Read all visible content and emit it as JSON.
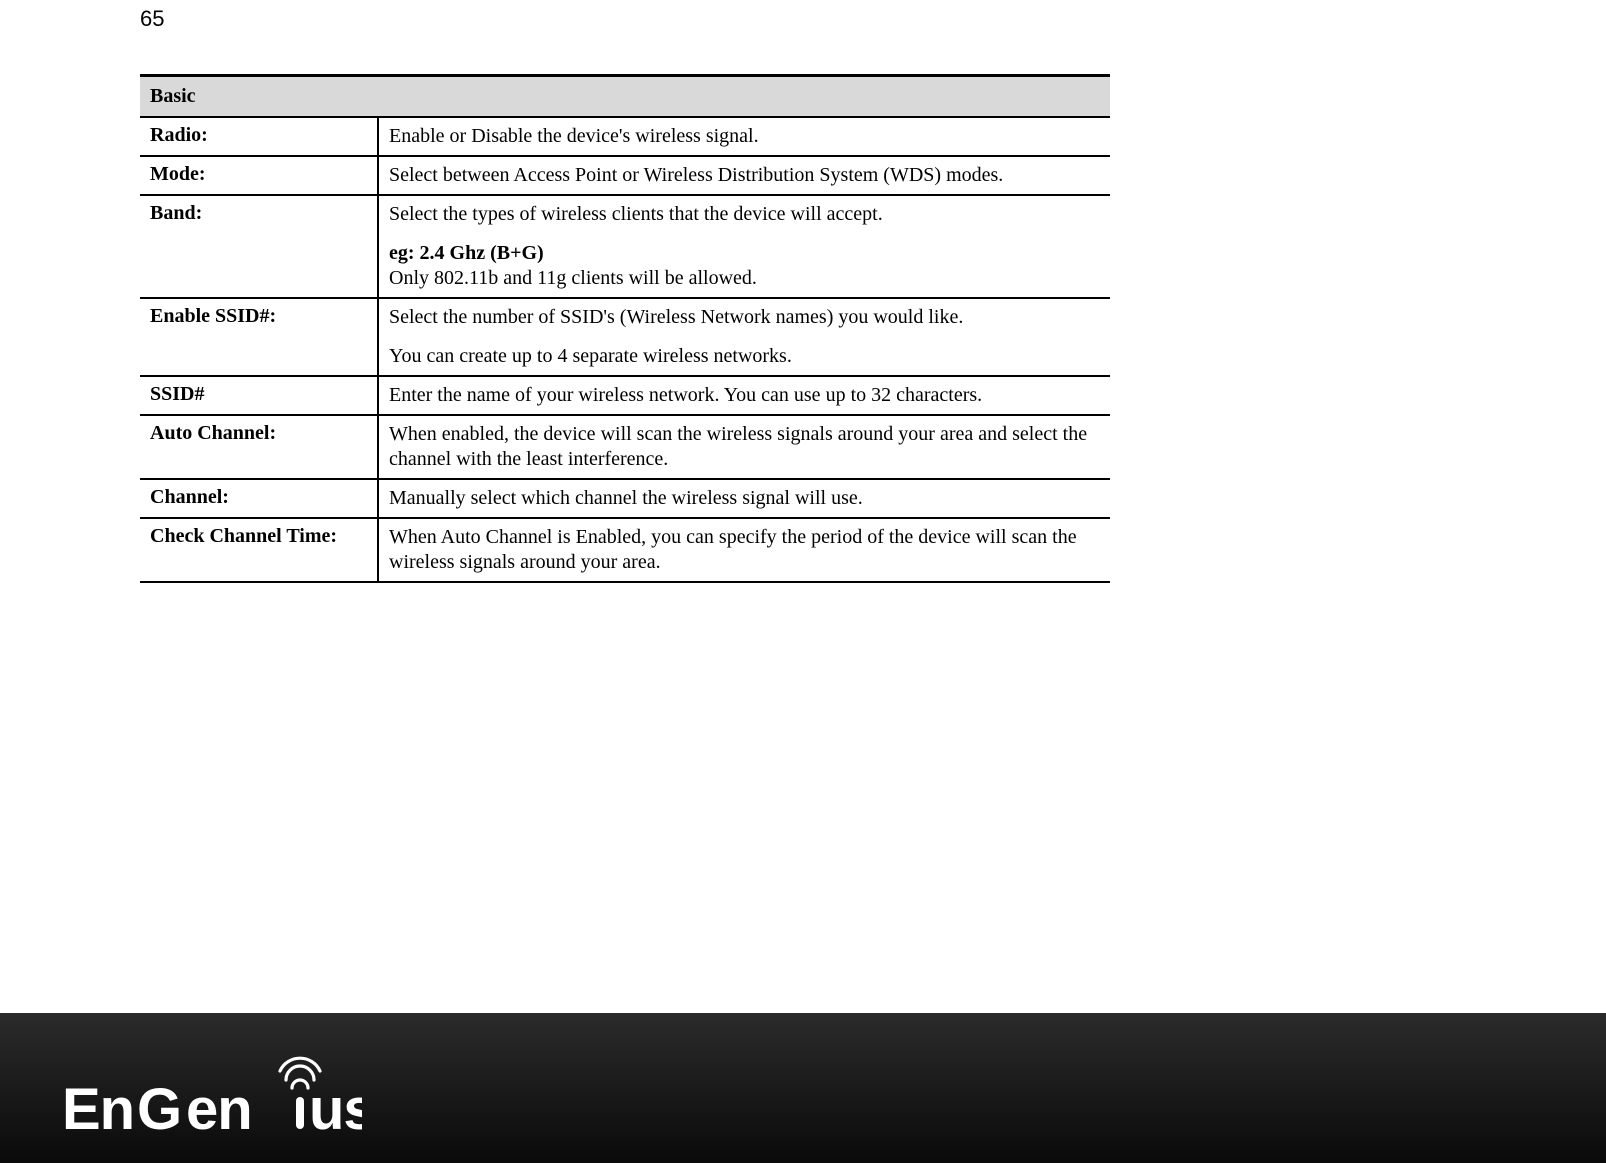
{
  "page_number": "65",
  "table": {
    "header": "Basic",
    "rows": [
      {
        "label": "Radio:",
        "desc_plain": "Enable or Disable the device's wireless signal."
      },
      {
        "label": "Mode:",
        "desc_plain": "Select between Access Point or Wireless Distribution System (WDS) modes."
      },
      {
        "label": "Band:",
        "desc_line1": "Select the types of wireless clients that the device will accept.",
        "desc_eg": "eg: 2.4 Ghz (B+G)",
        "desc_line3": "Only 802.11b and 11g clients will be allowed."
      },
      {
        "label": "Enable SSID#:",
        "desc_line1": "Select the number of SSID's (Wireless Network names) you would like.",
        "desc_line2": "You can create up to 4 separate wireless networks."
      },
      {
        "label": "SSID#",
        "desc_plain": "Enter the name of your wireless network. You can use up to 32 characters."
      },
      {
        "label": "Auto Channel:",
        "desc_plain": "When enabled, the device will scan the wireless signals around your area and select the channel with the least interference."
      },
      {
        "label": "Channel:",
        "desc_plain": "Manually select which channel the wireless signal will use."
      },
      {
        "label": "Check Channel Time:",
        "desc_plain": "When Auto Channel is Enabled, you can specify the period of the device will scan the wireless signals around your area."
      }
    ]
  },
  "footer": {
    "brand": "EnGenius",
    "registered": "®"
  }
}
